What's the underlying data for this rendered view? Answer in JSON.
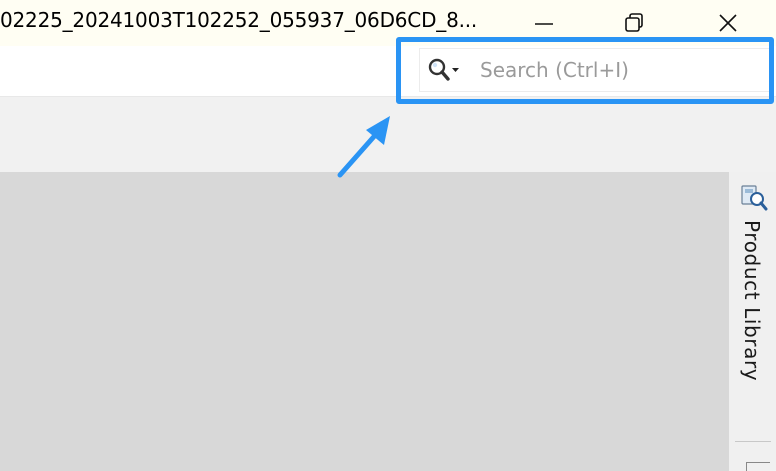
{
  "window": {
    "title": "02225_20241003T102252_055937_06D6CD_8...",
    "controls": {
      "minimize_icon": "minimize-icon",
      "restore_icon": "restore-icon",
      "close_icon": "close-icon"
    }
  },
  "search": {
    "placeholder": "Search (Ctrl+I)",
    "icon": "search-icon"
  },
  "colors": {
    "highlight": "#2a94f4",
    "canvas": "#d8d8d8",
    "titlebar": "#fffef3"
  },
  "side_panel": {
    "label": "Product Library",
    "icon": "product-library-icon"
  }
}
